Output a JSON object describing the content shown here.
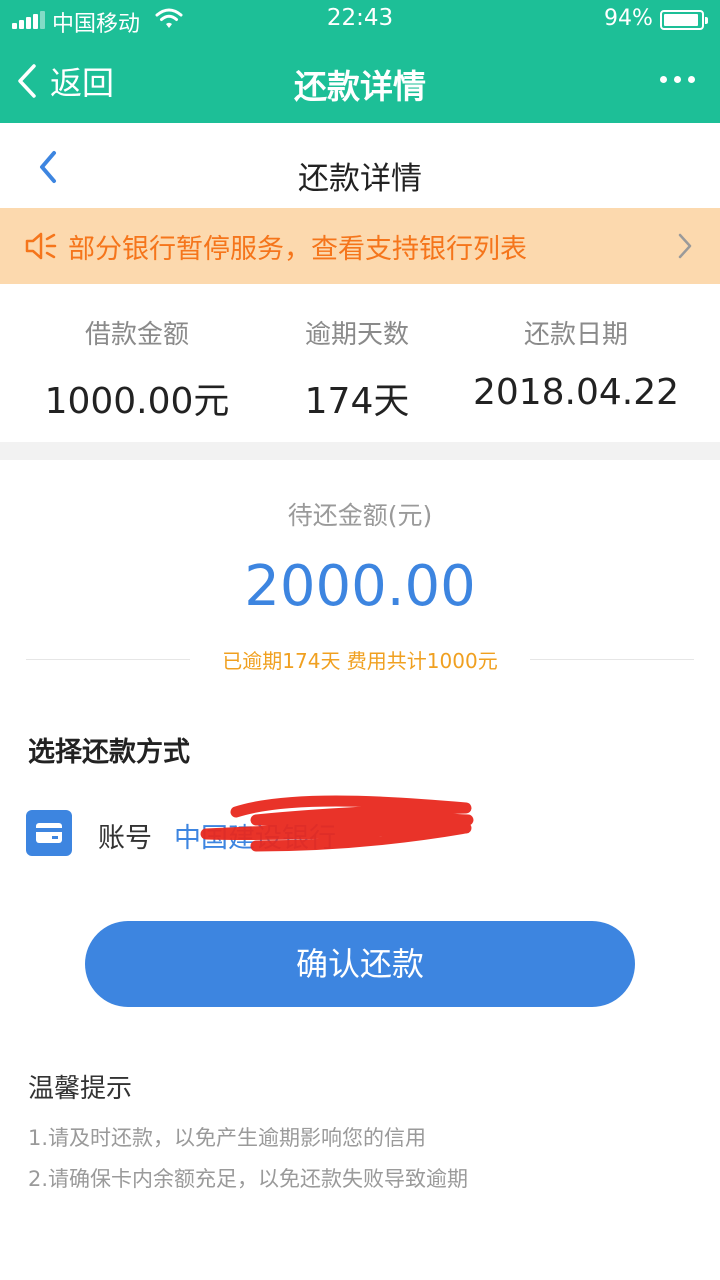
{
  "status_bar": {
    "carrier": "中国移动",
    "time": "22:43",
    "battery": "94%",
    "battery_level": 0.94
  },
  "nav": {
    "back_label": "返回",
    "title": "还款详情"
  },
  "page": {
    "title": "还款详情"
  },
  "notice": {
    "text": "部分银行暂停服务，查看支持银行列表"
  },
  "stats": [
    {
      "label": "借款金额",
      "value": "1000.00元"
    },
    {
      "label": "逾期天数",
      "value": "174天"
    },
    {
      "label": "还款日期",
      "value": "2018.04.22"
    }
  ],
  "amount": {
    "label": "待还金额(元)",
    "value": "2000.00",
    "overdue_note": "已逾期174天 费用共计1000元"
  },
  "method": {
    "title": "选择还款方式",
    "label": "账号",
    "bank": "中国建设银行"
  },
  "confirm": {
    "label": "确认还款"
  },
  "tips": {
    "title": "温馨提示",
    "items": [
      "1.请及时还款，以免产生逾期影响您的信用",
      "2.请确保卡内余额充足，以免还款失败导致逾期"
    ]
  },
  "colors": {
    "header": "#1dbf97",
    "accent": "#3d85e0",
    "notice_bg": "#fcd9ae",
    "notice_text": "#f5751b",
    "overdue_text": "#f0a020",
    "redaction": "#e8281e"
  }
}
